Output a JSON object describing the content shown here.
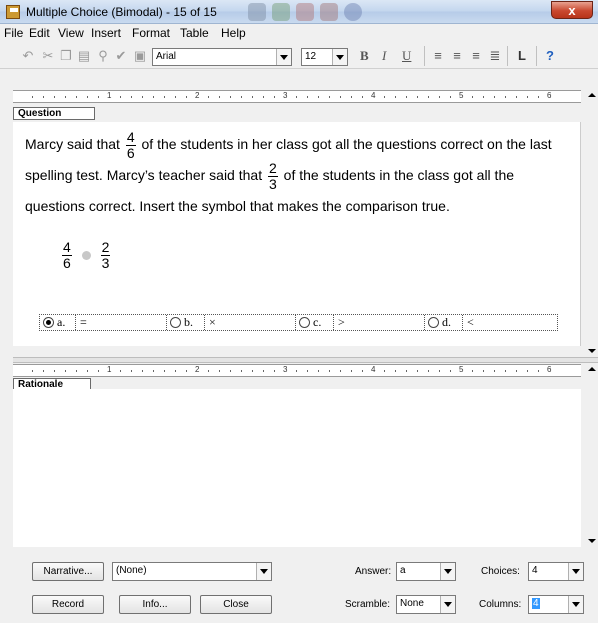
{
  "window": {
    "title": "Multiple Choice (Bimodal) - 15 of 15",
    "close_glyph": "x"
  },
  "menu": [
    "File",
    "Edit",
    "View",
    "Insert",
    "Format",
    "Table",
    "Help"
  ],
  "toolbar": {
    "font_name": "Arial",
    "font_size": "12",
    "bold": "B",
    "italic": "I",
    "underline": "U"
  },
  "ruler": {
    "numbers": [
      "1",
      "2",
      "3",
      "4",
      "5",
      "6"
    ]
  },
  "question": {
    "label": "Question",
    "text_part1": "Marcy said that",
    "frac1": {
      "num": "4",
      "den": "6"
    },
    "text_part2": "of the students in her class got all the questions correct on the last spelling test. Marcy’s teacher said that",
    "frac2": {
      "num": "2",
      "den": "3"
    },
    "text_part3": "of the students in the class got all the questions  correct. Insert the symbol that makes the comparison true.",
    "comparison": {
      "left": {
        "num": "4",
        "den": "6"
      },
      "right": {
        "num": "2",
        "den": "3"
      }
    }
  },
  "choices": [
    {
      "letter": "a.",
      "value": "=",
      "selected": true
    },
    {
      "letter": "b.",
      "value": "×",
      "selected": false
    },
    {
      "letter": "c.",
      "value": ">",
      "selected": false
    },
    {
      "letter": "d.",
      "value": "<",
      "selected": false
    }
  ],
  "rationale": {
    "label": "Rationale"
  },
  "footer": {
    "narrative_button": "Narrative...",
    "narrative_value": "(None)",
    "answer_label": "Answer:",
    "answer_value": "a",
    "choices_label": "Choices:",
    "choices_value": "4",
    "record_button": "Record",
    "info_button": "Info...",
    "close_button": "Close",
    "scramble_label": "Scramble:",
    "scramble_value": "None",
    "columns_label": "Columns:",
    "columns_value": "4"
  },
  "colors": {
    "title_gradient": "#c3d6ee",
    "close_red": "#c9482f",
    "selection_blue": "#3399ff"
  }
}
